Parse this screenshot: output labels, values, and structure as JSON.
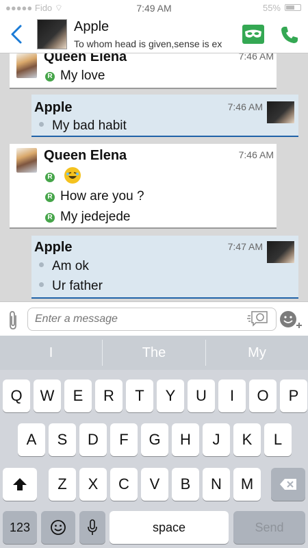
{
  "status_bar": {
    "carrier": "●●●●● Fido ⌔",
    "time": "7:49 AM",
    "battery": "55%"
  },
  "header": {
    "back_icon": "chevron-left-icon",
    "contact_name": "Apple",
    "status_message": "To whom head is given,sense is ex",
    "mask_icon": "mask-icon",
    "phone_icon": "phone-icon",
    "accent_color": "#1b7bd6",
    "green_color": "#34a853"
  },
  "messages": [
    {
      "sender": "Queen Elena",
      "time": "7:46 AM",
      "direction": "in",
      "lines": [
        "My love"
      ],
      "receipt": "R"
    },
    {
      "sender": "Apple",
      "time": "7:46 AM",
      "direction": "out",
      "lines": [
        "My bad habit"
      ]
    },
    {
      "sender": "Queen Elena",
      "time": "7:46 AM",
      "direction": "in",
      "lines": [
        "",
        "How are you ?",
        "My jedejede"
      ],
      "receipt": "R",
      "emoji": "laughing-emoji-icon"
    },
    {
      "sender": "Apple",
      "time": "7:47 AM",
      "direction": "out",
      "lines": [
        "Am ok",
        "Ur father"
      ]
    }
  ],
  "composer": {
    "placeholder": "Enter a message",
    "attach_icon": "paperclip-icon",
    "sticker_icon": "sticker-icon",
    "emoji_icon": "emoji-add-icon"
  },
  "suggestions": [
    "I",
    "The",
    "My"
  ],
  "keyboard": {
    "row1": [
      "Q",
      "W",
      "E",
      "R",
      "T",
      "Y",
      "U",
      "I",
      "O",
      "P"
    ],
    "row2": [
      "A",
      "S",
      "D",
      "F",
      "G",
      "H",
      "J",
      "K",
      "L"
    ],
    "row3": [
      "Z",
      "X",
      "C",
      "V",
      "B",
      "N",
      "M"
    ],
    "numbers_label": "123",
    "space_label": "space",
    "send_label": "Send",
    "shift_icon": "shift-icon",
    "backspace_icon": "backspace-icon",
    "emoji_key_icon": "emoji-key-icon",
    "mic_icon": "microphone-icon"
  }
}
